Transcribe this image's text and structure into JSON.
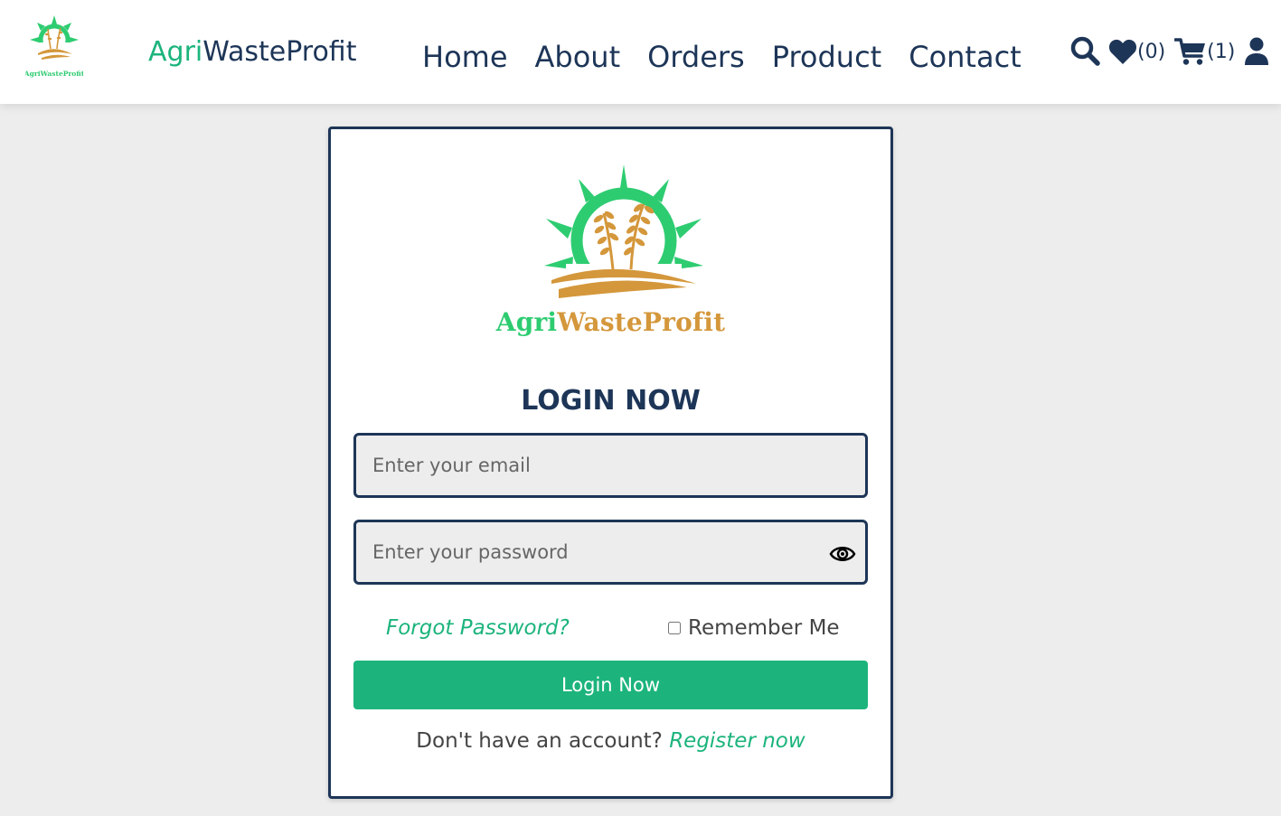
{
  "header": {
    "logo_text": "AgriWasteProfit",
    "brand": {
      "accent": "Agri",
      "rest": "WasteProfit"
    },
    "nav": [
      {
        "label": "Home"
      },
      {
        "label": "About"
      },
      {
        "label": "Orders"
      },
      {
        "label": "Product"
      },
      {
        "label": "Contact"
      }
    ],
    "icons": {
      "search": "search-icon",
      "wishlist": "heart-icon",
      "wishlist_count": "(0)",
      "cart": "cart-icon",
      "cart_count": "(1)",
      "user": "user-icon"
    }
  },
  "login": {
    "logo": {
      "green": "Agri",
      "orange": "WasteProfit"
    },
    "title": "LOGIN NOW",
    "email_placeholder": "Enter your email",
    "password_placeholder": "Enter your password",
    "forgot_label": "Forgot Password?",
    "remember_label": "Remember Me",
    "remember_checked": false,
    "submit_label": "Login Now",
    "register_prompt": "Don't have an account?",
    "register_link": "Register now"
  },
  "colors": {
    "accent_green": "#1cb47c",
    "navy": "#1d3557",
    "logo_green": "#2ecc71",
    "logo_orange": "#d4973b",
    "page_bg": "#ededed"
  }
}
